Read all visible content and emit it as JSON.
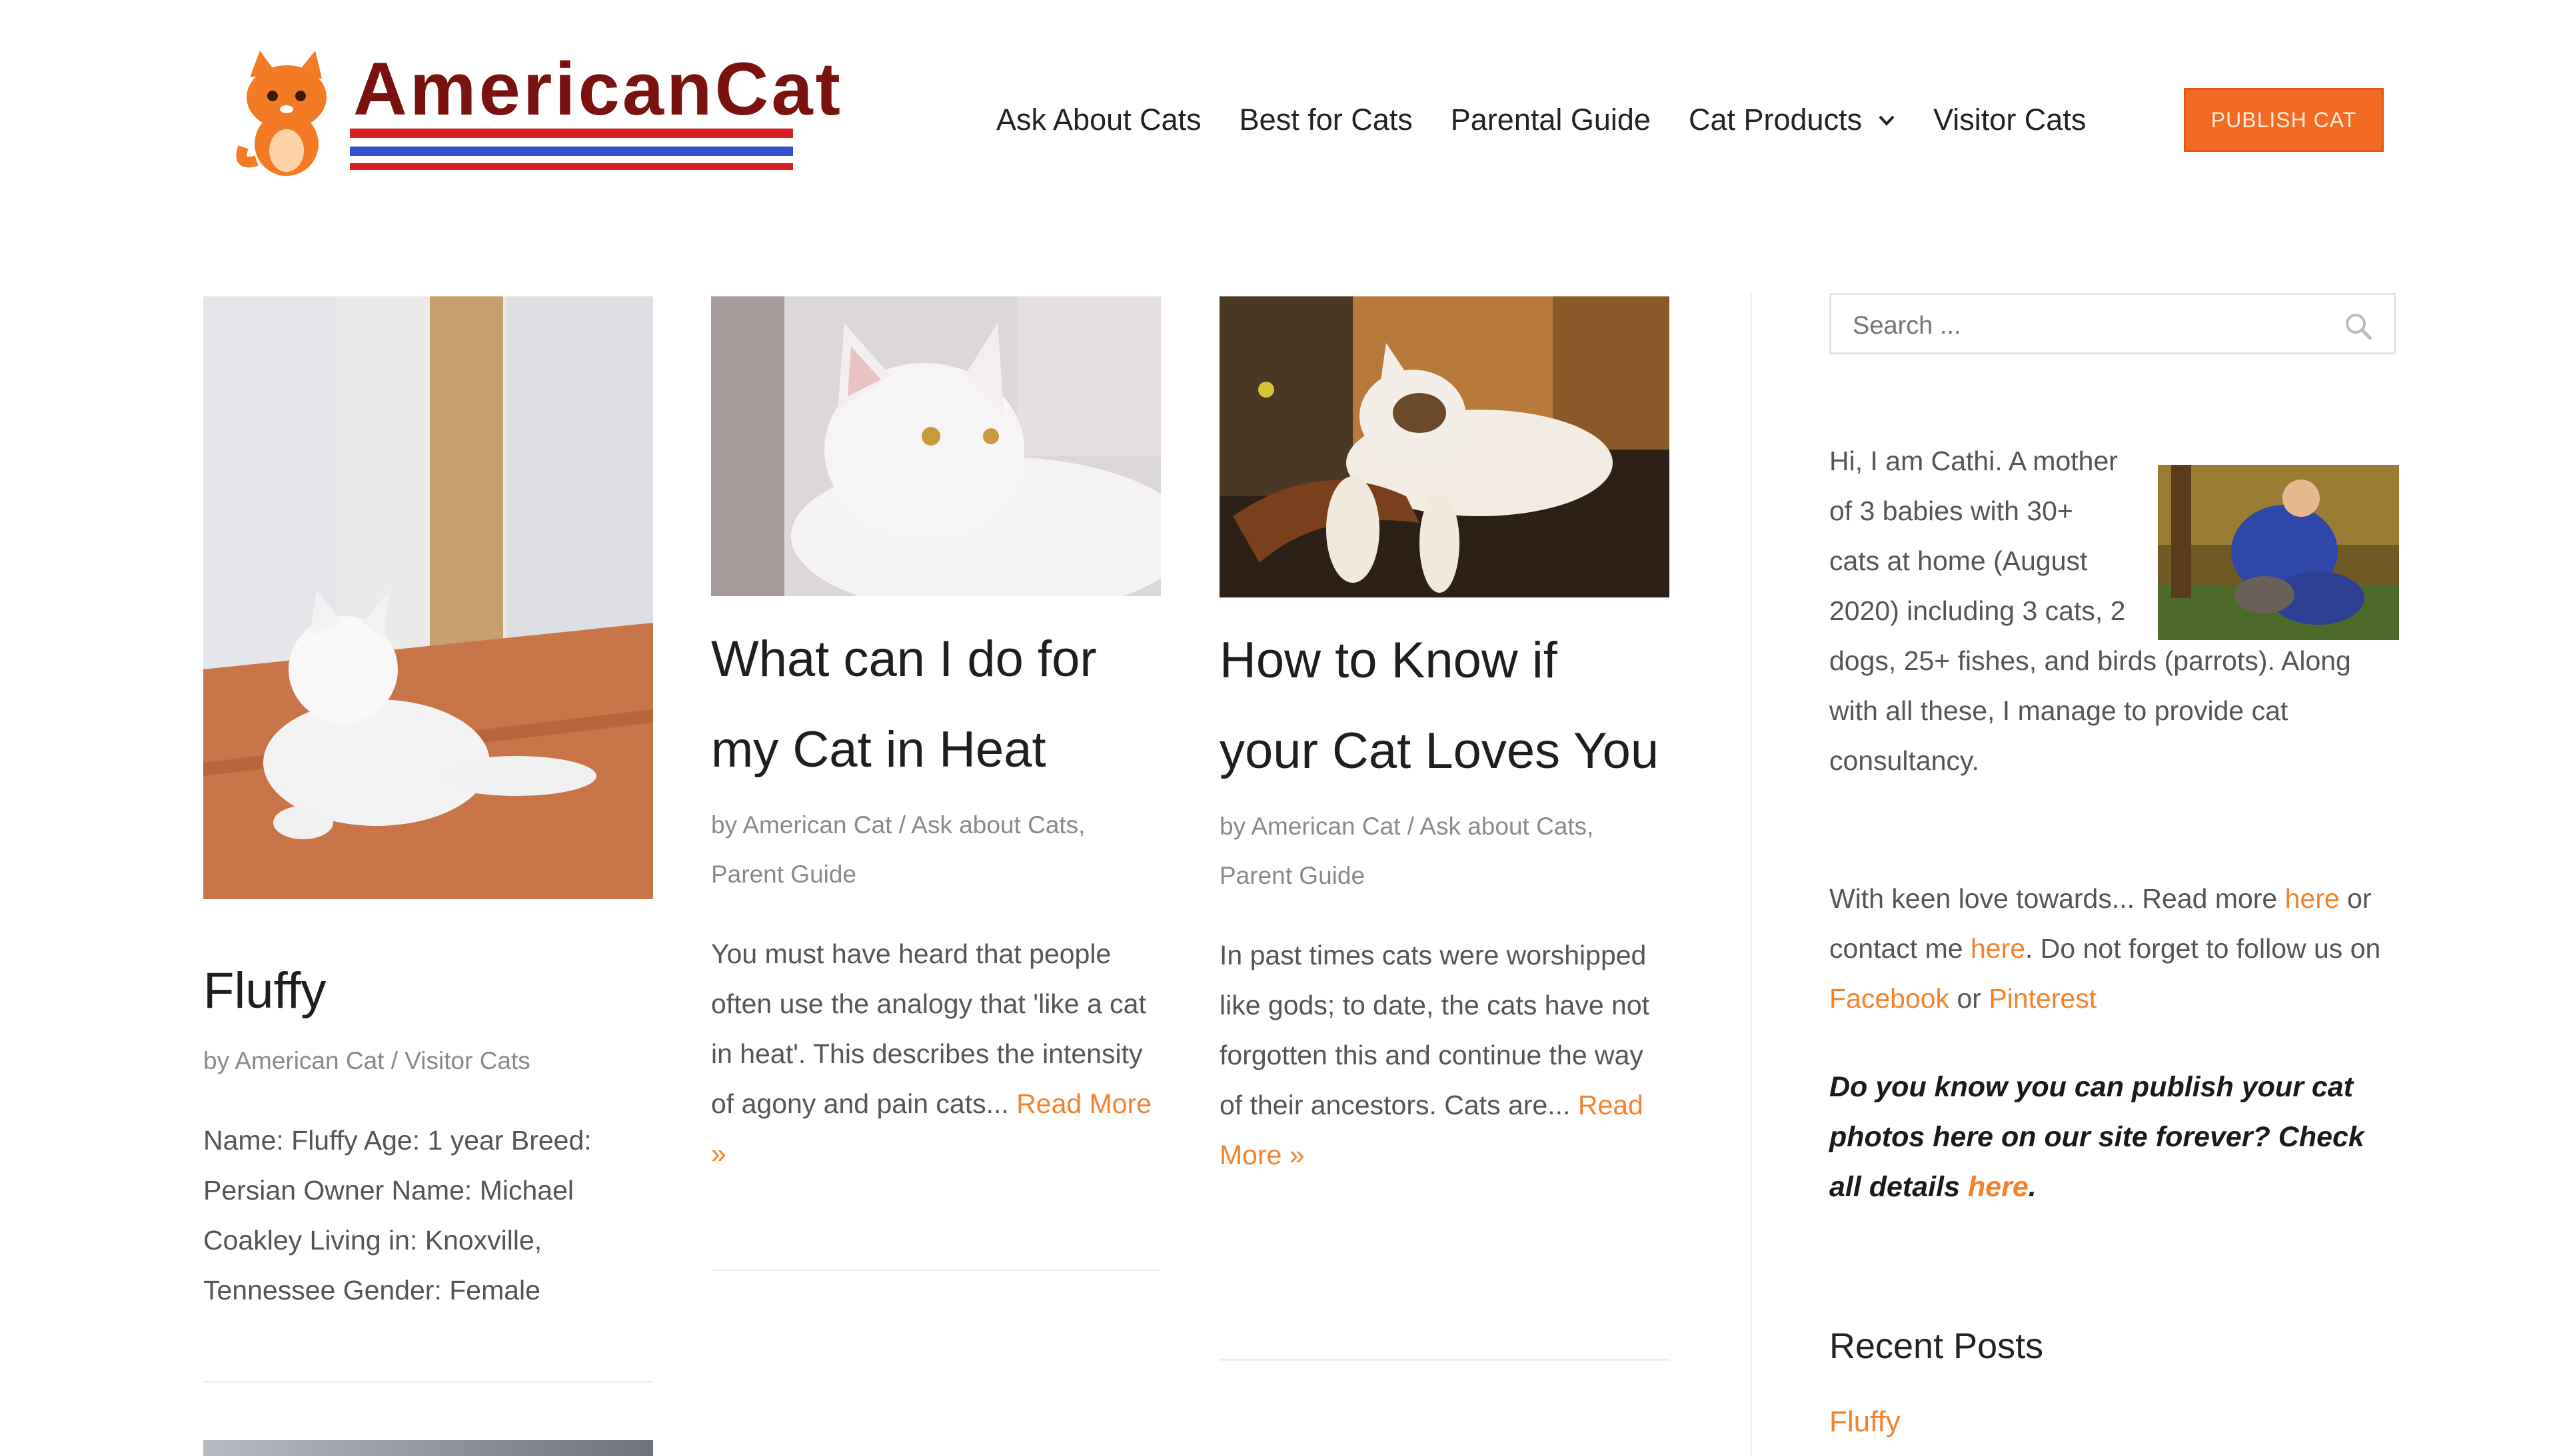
{
  "header": {
    "logo_text": "AmericanCat",
    "nav": [
      "Ask About Cats",
      "Best for Cats",
      "Parental Guide",
      "Cat Products",
      "Visitor Cats"
    ],
    "publish_button": "PUBLISH CAT"
  },
  "posts": [
    {
      "title": "Fluffy",
      "author": "by American Cat",
      "sep": " / ",
      "categories": "Visitor Cats",
      "excerpt": "Name: Fluffy Age: 1 year Breed: Persian Owner Name: Michael Coakley Living in: Knoxville, Tennessee Gender: Female"
    },
    {
      "title": "What can I do for my Cat in Heat",
      "author": "by American Cat",
      "sep": " / ",
      "categories": "Ask about Cats, Parent Guide",
      "excerpt": "You must have heard that people often use the analogy that 'like a cat in heat'. This describes the intensity of agony and pain cats...",
      "read_more": "Read More »"
    },
    {
      "title": "How to Know if your Cat Loves You",
      "author": "by American Cat",
      "sep": " / ",
      "categories": "Ask about Cats, Parent Guide",
      "excerpt": "In past times cats were worshipped like gods; to date, the cats have not forgotten this and continue the way of their ancestors. Cats are...",
      "read_more": "Read More »"
    }
  ],
  "sidebar": {
    "search_placeholder": "Search ...",
    "about": "Hi, I am Cathi. A mother of 3 babies with 30+ cats at home (August 2020) including 3 cats, 2 dogs, 25+ fishes, and birds (parrots). Along with all these, I manage to provide cat consultancy.",
    "contact": {
      "p1": "With keen love towards... Read more ",
      "here1": "here",
      "p2": " or contact me ",
      "here2": "here",
      "p3": ". Do not forget to follow us on ",
      "facebook": "Facebook",
      "or": " or ",
      "pinterest": "Pinterest"
    },
    "publish_note": "Do you know you can publish your cat photos here on our site forever? Check all details ",
    "publish_link": "here",
    "publish_end": ".",
    "recent_title": "Recent Posts",
    "recent_posts": [
      "Fluffy"
    ]
  },
  "colors": {
    "accent": "#f5822a",
    "logo": "#7a1212",
    "button": "#f26b22"
  }
}
